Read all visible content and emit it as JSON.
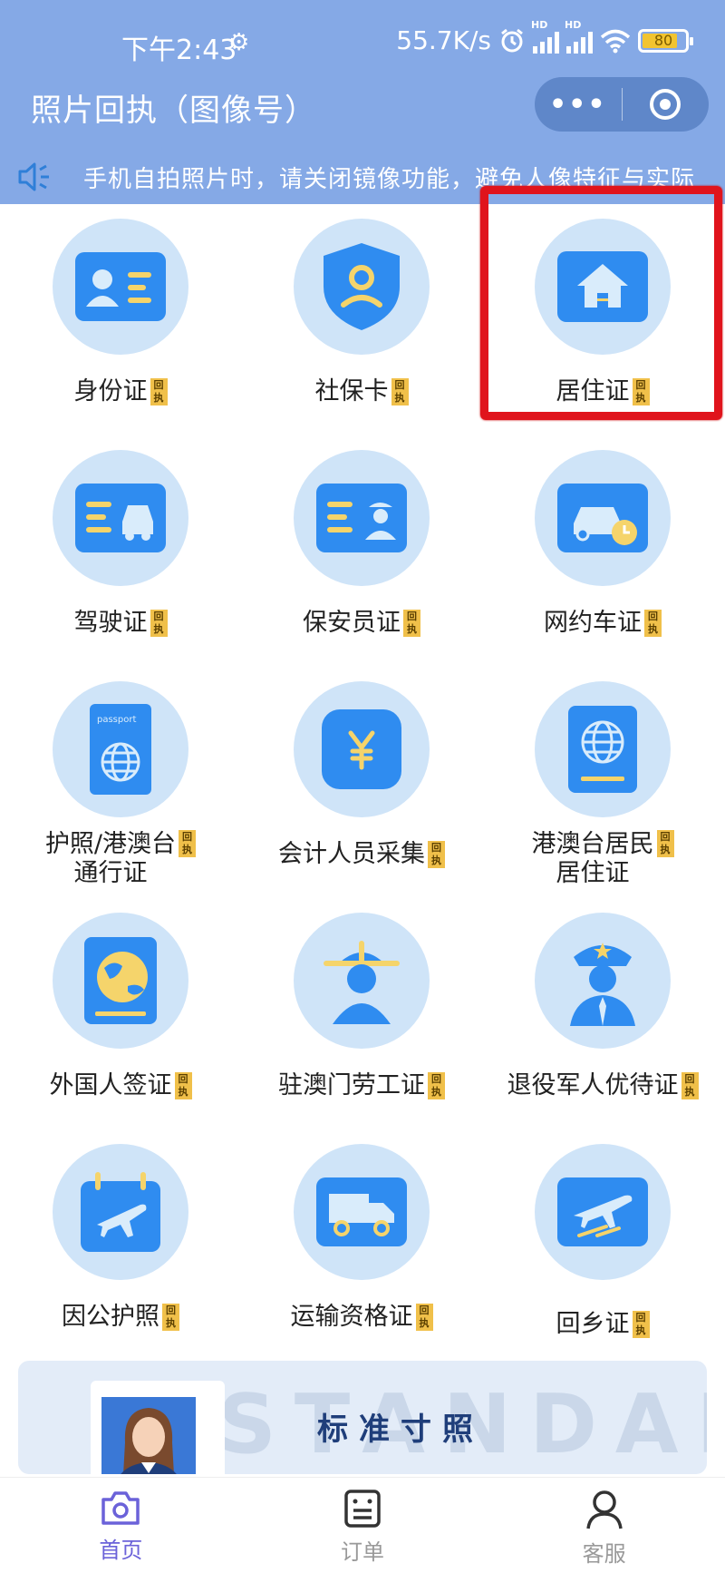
{
  "status_bar": {
    "time": "下午2:43",
    "network_speed": "55.7K/s",
    "battery": "80"
  },
  "nav": {
    "title": "照片回执（图像号）"
  },
  "notice": {
    "text": "手机自拍照片时，请关闭镜像功能，避免人像特征与实际"
  },
  "badge_text": "回执",
  "grid": [
    {
      "label": "身份证"
    },
    {
      "label": "社保卡"
    },
    {
      "label": "居住证",
      "highlighted": true
    },
    {
      "label": "驾驶证"
    },
    {
      "label": "保安员证"
    },
    {
      "label": "网约车证"
    },
    {
      "label": "护照/港澳台",
      "label2": "通行证"
    },
    {
      "label": "会计人员采集"
    },
    {
      "label": "港澳台居民",
      "label2": "居住证"
    },
    {
      "label": "外国人签证"
    },
    {
      "label": "驻澳门劳工证"
    },
    {
      "label": "退役军人优待证"
    },
    {
      "label": "因公护照"
    },
    {
      "label": "运输资格证"
    },
    {
      "label": "回乡证"
    }
  ],
  "banner": {
    "title": "标准寸照",
    "watermark": "STANDAR"
  },
  "tabbar": [
    {
      "label": "首页",
      "active": true
    },
    {
      "label": "订单",
      "active": false
    },
    {
      "label": "客服",
      "active": false
    }
  ],
  "colors": {
    "header": "#85a9e6",
    "circle": "#cfe4f8",
    "icon_blue": "#2f8cf0",
    "badge": "#f0c04a",
    "highlight": "#e0141c",
    "tab_active": "#6b62d9"
  }
}
